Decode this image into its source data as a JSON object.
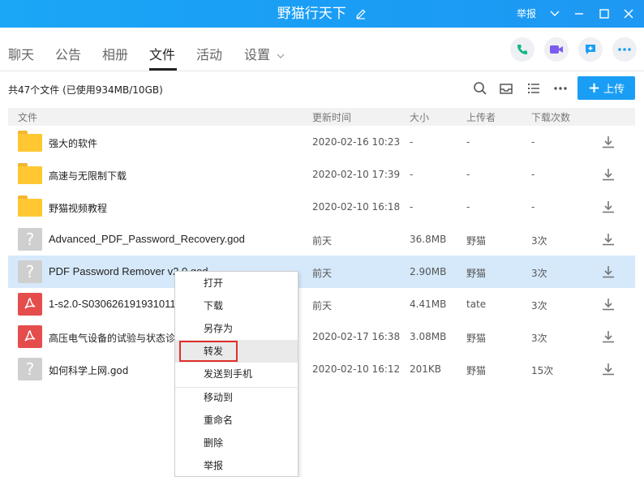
{
  "window": {
    "title": "野猫行天下",
    "report": "举报"
  },
  "nav": {
    "tabs": [
      "聊天",
      "公告",
      "相册",
      "文件",
      "活动",
      "设置"
    ],
    "active_tab": "文件"
  },
  "toolbar": {
    "summary": "共47个文件 (已使用934MB/10GB)",
    "upload_label": "上传"
  },
  "table": {
    "headers": [
      "文件",
      "更新时间",
      "大小",
      "上传者",
      "下载次数"
    ],
    "rows": [
      {
        "icon": "folder-icon",
        "name": "强大的软件",
        "time": "2020-02-16 10:23",
        "size": "-",
        "uploader": "-",
        "downloads": "-"
      },
      {
        "icon": "folder-icon",
        "name": "高速与无限制下载",
        "time": "2020-02-10 17:39",
        "size": "-",
        "uploader": "-",
        "downloads": "-"
      },
      {
        "icon": "folder-icon",
        "name": "野猫视频教程",
        "time": "2020-02-10 16:18",
        "size": "-",
        "uploader": "-",
        "downloads": "-"
      },
      {
        "icon": "unknown-file-icon",
        "name": "Advanced_PDF_Password_Recovery.god",
        "time": "前天",
        "size": "36.8MB",
        "uploader": "野猫",
        "downloads": "3次"
      },
      {
        "icon": "unknown-file-icon",
        "name": "PDF Password Remover v2.0.god",
        "time": "前天",
        "size": "2.90MB",
        "uploader": "野猫",
        "downloads": "3次"
      },
      {
        "icon": "pdf-file-icon",
        "name": "1-s2.0-S030626191931011",
        "time": "前天",
        "size": "4.41MB",
        "uploader": "tate",
        "downloads": "3次"
      },
      {
        "icon": "pdf-file-icon",
        "name": "高压电气设备的试验与状态诊",
        "time": "2020-02-17 16:38",
        "size": "3.08MB",
        "uploader": "野猫",
        "downloads": "3次"
      },
      {
        "icon": "unknown-file-icon",
        "name": "如何科学上网.god",
        "time": "2020-02-10 16:12",
        "size": "201KB",
        "uploader": "野猫",
        "downloads": "15次"
      }
    ]
  },
  "context_menu": {
    "items": [
      "打开",
      "下载",
      "另存为",
      "转发",
      "发送到手机",
      "移动到",
      "重命名",
      "删除",
      "举报"
    ],
    "highlighted": "转发"
  },
  "colors": {
    "titlebar": "#1a9ef5",
    "selected_row": "#d6e9fb",
    "highlight_border": "#e0302b",
    "folder": "#ffc833",
    "pdf": "#e54d4d"
  }
}
